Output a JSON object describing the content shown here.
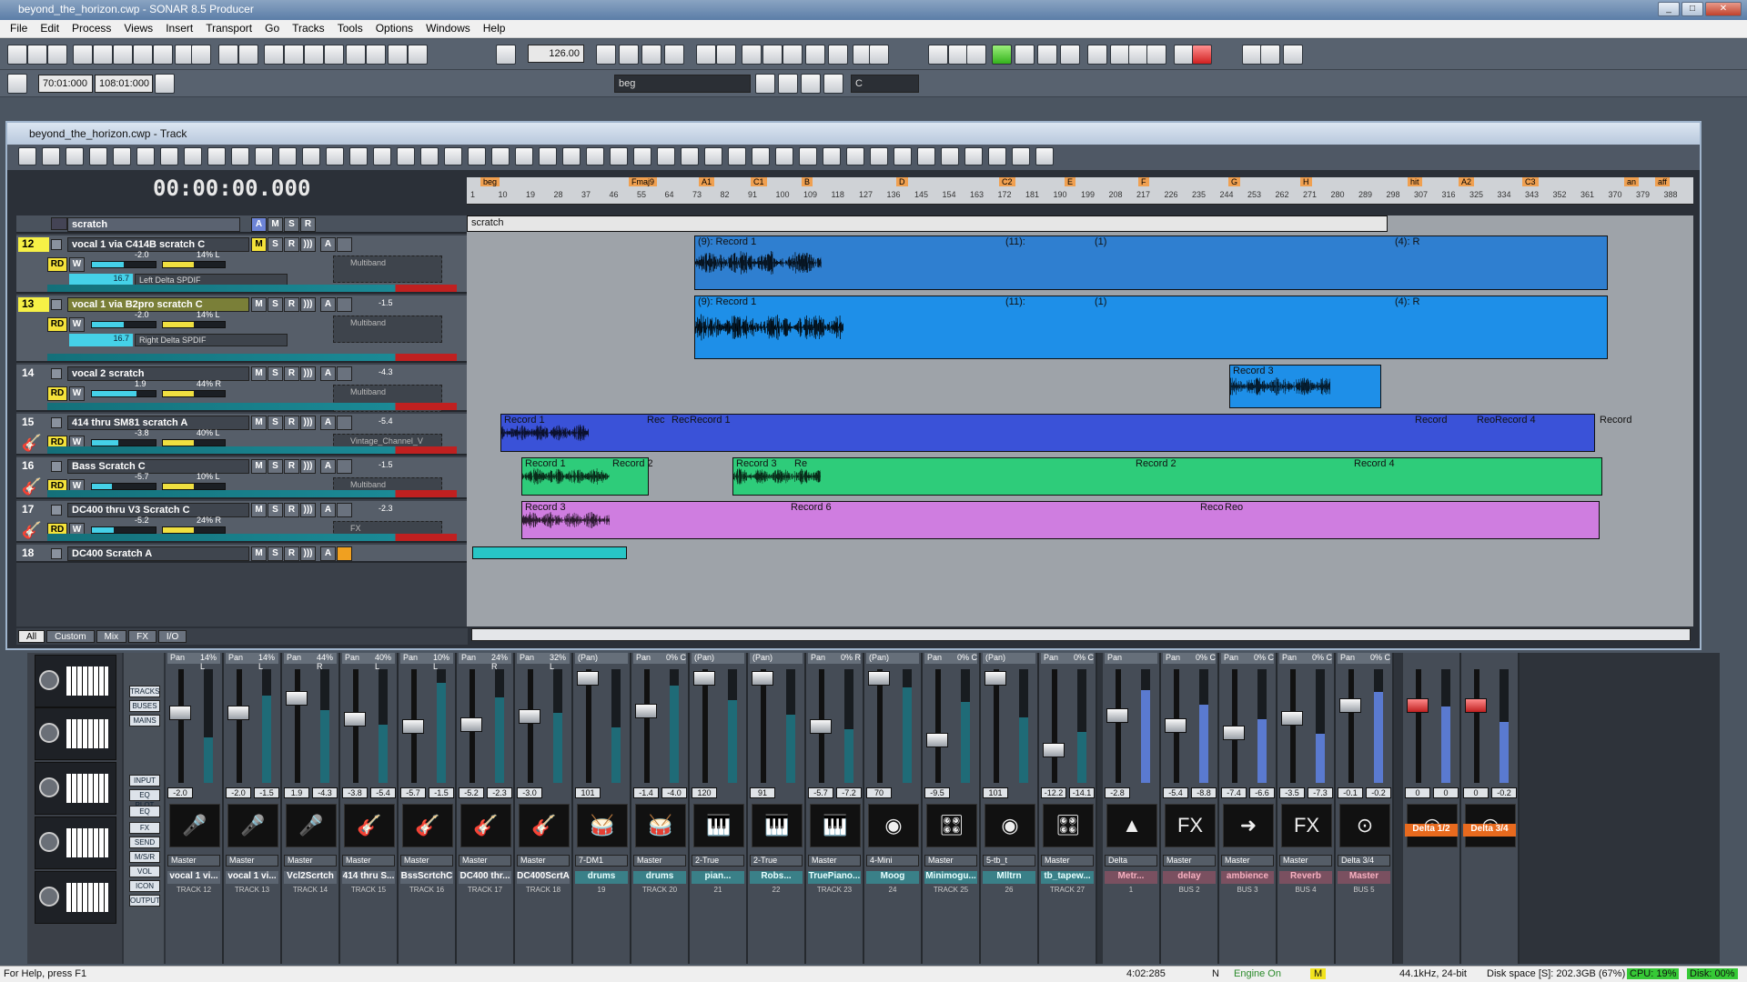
{
  "app_title": "beyond_the_horizon.cwp - SONAR 8.5 Producer",
  "menu": [
    "File",
    "Edit",
    "Process",
    "Views",
    "Insert",
    "Transport",
    "Go",
    "Tracks",
    "Tools",
    "Options",
    "Windows",
    "Help"
  ],
  "transport": {
    "tempo": "126.00",
    "loop_start": "70:01:000",
    "loop_end": "108:01:000",
    "marker": "beg",
    "key": "C"
  },
  "track_window": {
    "title": "beyond_the_horizon.cwp - Track",
    "time": "00:00:00.000",
    "ruler_numbers": [
      "1",
      "10",
      "19",
      "28",
      "37",
      "46",
      "55",
      "64",
      "73",
      "82",
      "91",
      "100",
      "109",
      "118",
      "127",
      "136",
      "145",
      "154",
      "163",
      "172",
      "181",
      "190",
      "199",
      "208",
      "217",
      "226",
      "235",
      "244",
      "253",
      "262",
      "271",
      "280",
      "289",
      "298",
      "307",
      "316",
      "325",
      "334",
      "343",
      "352",
      "361",
      "370",
      "379",
      "388"
    ],
    "ruler_markers": [
      "beg",
      "Fmaj9",
      "A1",
      "C1",
      "B",
      "D",
      "C2",
      "E",
      "F",
      "G",
      "H",
      "hit",
      "A2",
      "C3",
      "an",
      "aff"
    ],
    "folder": {
      "name": "scratch",
      "clip": "scratch"
    },
    "tracks": [
      {
        "num": "12",
        "name": "vocal 1 via C414B scratch C",
        "vol": "-2.0",
        "pan": "14% L",
        "trim": "16.7",
        "input": "Left Delta SPDIF",
        "fx": "Multiband",
        "db": "",
        "sel": true
      },
      {
        "num": "13",
        "name": "vocal 1 via B2pro scratch C",
        "vol": "-2.0",
        "pan": "14% L",
        "trim": "16.7",
        "input": "Right Delta SPDIF",
        "fx": "Multiband",
        "db": "-1.5",
        "sel": true
      },
      {
        "num": "14",
        "name": "vocal 2 scratch",
        "vol": "1.9",
        "pan": "44% R",
        "trim": "",
        "input": "",
        "fx": "Multiband",
        "db": "-4.3",
        "sel": false
      },
      {
        "num": "15",
        "name": "414 thru SM81 scratch A",
        "vol": "-3.8",
        "pan": "40% L",
        "trim": "",
        "input": "",
        "fx": "Vintage_Channel_V",
        "db": "-5.4",
        "sel": false
      },
      {
        "num": "16",
        "name": "Bass Scratch C",
        "vol": "-5.7",
        "pan": "10% L",
        "trim": "",
        "input": "",
        "fx": "Multiband",
        "db": "-1.5",
        "sel": false
      },
      {
        "num": "17",
        "name": "DC400 thru V3 Scratch C",
        "vol": "-5.2",
        "pan": "24% R",
        "trim": "",
        "input": "",
        "fx": "FX",
        "db": "-2.3",
        "sel": false
      },
      {
        "num": "18",
        "name": "DC400 Scratch A",
        "vol": "",
        "pan": "",
        "trim": "",
        "input": "",
        "fx": "",
        "db": "",
        "sel": false
      }
    ],
    "clip_labels": {
      "t12": [
        "(9): Record 1",
        "(11):",
        "(1)",
        "(4): R"
      ],
      "t13": [
        "(9): Record 1",
        "(11):",
        "(1)",
        "(4): R"
      ],
      "t14": [
        "Record 3"
      ],
      "t15": [
        "Record 1",
        "Rec",
        "Rec",
        "Record 1",
        "Record",
        "Reo",
        "Record 4",
        "Record"
      ],
      "t16": [
        "Record 1",
        "Record 2",
        "Record 3",
        "Re",
        "Record 2",
        "Record 4"
      ],
      "t17": [
        "Record 3",
        "Record 6",
        "Reco",
        "Reo"
      ]
    },
    "tabs": [
      "All",
      "Custom",
      "Mix",
      "FX",
      "I/O"
    ],
    "buttons": {
      "a": "A",
      "m": "M",
      "s": "S",
      "r": "R",
      "rd": "RD",
      "w": "W"
    }
  },
  "console": {
    "nav": [
      "TRACKS",
      "BUSES",
      "MAINS",
      "INPUT",
      "EQ PLOT",
      "EQ",
      "FX",
      "SEND",
      "M/S/R",
      "VOL",
      "ICON",
      "OUTPUT"
    ],
    "strips": [
      {
        "pan": "Pan",
        "pv": "14% L",
        "dv": [
          "-2.0",
          ""
        ],
        "icon": "🎤",
        "out": "Master",
        "name": "vocal 1 vi...",
        "tk": "TRACK 12",
        "style": ""
      },
      {
        "pan": "Pan",
        "pv": "14% L",
        "dv": [
          "-2.0",
          "-1.5"
        ],
        "icon": "🎤",
        "out": "Master",
        "name": "vocal 1 vi...",
        "tk": "TRACK 13",
        "style": ""
      },
      {
        "pan": "Pan",
        "pv": "44% R",
        "dv": [
          "1.9",
          "-4.3"
        ],
        "icon": "🎤",
        "out": "Master",
        "name": "Vcl2Scrtch",
        "tk": "TRACK 14",
        "style": ""
      },
      {
        "pan": "Pan",
        "pv": "40% L",
        "dv": [
          "-3.8",
          "-5.4"
        ],
        "icon": "🎸",
        "out": "Master",
        "name": "414 thru S...",
        "tk": "TRACK 15",
        "style": ""
      },
      {
        "pan": "Pan",
        "pv": "10% L",
        "dv": [
          "-5.7",
          "-1.5"
        ],
        "icon": "🎸",
        "out": "Master",
        "name": "BssScrtchC",
        "tk": "TRACK 16",
        "style": ""
      },
      {
        "pan": "Pan",
        "pv": "24% R",
        "dv": [
          "-5.2",
          "-2.3"
        ],
        "icon": "🎸",
        "out": "Master",
        "name": "DC400 thr...",
        "tk": "TRACK 17",
        "style": ""
      },
      {
        "pan": "Pan",
        "pv": "32% L",
        "dv": [
          "-3.0",
          ""
        ],
        "icon": "🎸",
        "out": "Master",
        "name": "DC400ScrtA",
        "tk": "TRACK 18",
        "style": ""
      },
      {
        "pan": "(Pan)",
        "pv": "",
        "dv": [
          "101",
          ""
        ],
        "icon": "🥁",
        "out": "7-DM1",
        "name": "drums",
        "tk": "19",
        "style": "teal"
      },
      {
        "pan": "Pan",
        "pv": "0% C",
        "dv": [
          "-1.4",
          "-4.0"
        ],
        "icon": "🥁",
        "out": "Master",
        "name": "drums",
        "tk": "TRACK 20",
        "style": "teal"
      },
      {
        "pan": "(Pan)",
        "pv": "",
        "dv": [
          "120",
          ""
        ],
        "icon": "🎹",
        "out": "2-True",
        "name": "pian...",
        "tk": "21",
        "style": "teal"
      },
      {
        "pan": "(Pan)",
        "pv": "",
        "dv": [
          "91",
          ""
        ],
        "icon": "🎹",
        "out": "2-True",
        "name": "Robs...",
        "tk": "22",
        "style": "teal"
      },
      {
        "pan": "Pan",
        "pv": "0% R",
        "dv": [
          "-5.7",
          "-7.2"
        ],
        "icon": "🎹",
        "out": "Master",
        "name": "TruePiano...",
        "tk": "TRACK 23",
        "style": "teal"
      },
      {
        "pan": "(Pan)",
        "pv": "",
        "dv": [
          "70",
          ""
        ],
        "icon": "◉",
        "out": "4-Mini",
        "name": "Moog",
        "tk": "24",
        "style": "teal"
      },
      {
        "pan": "Pan",
        "pv": "0% C",
        "dv": [
          "-9.5",
          ""
        ],
        "icon": "🎛",
        "out": "Master",
        "name": "Minimogu...",
        "tk": "TRACK 25",
        "style": "teal"
      },
      {
        "pan": "(Pan)",
        "pv": "",
        "dv": [
          "101",
          ""
        ],
        "icon": "◉",
        "out": "5-tb_t",
        "name": "Mlltrn",
        "tk": "26",
        "style": "teal"
      },
      {
        "pan": "Pan",
        "pv": "0% C",
        "dv": [
          "-12.2",
          "-14.1"
        ],
        "icon": "🎛",
        "out": "Master",
        "name": "tb_tapew...",
        "tk": "TRACK 27",
        "style": "teal"
      },
      {
        "pan": "Pan",
        "pv": "",
        "dv": [
          "-2.8",
          ""
        ],
        "icon": "▲",
        "out": "Delta",
        "name": "Metr...",
        "tk": "1",
        "style": "red"
      },
      {
        "pan": "Pan",
        "pv": "0% C",
        "dv": [
          "-5.4",
          "-8.8"
        ],
        "icon": "FX",
        "out": "Master",
        "name": "delay",
        "tk": "BUS 2",
        "style": "red"
      },
      {
        "pan": "Pan",
        "pv": "0% C",
        "dv": [
          "-7.4",
          "-6.6"
        ],
        "icon": "➜",
        "out": "Master",
        "name": "ambience",
        "tk": "BUS 3",
        "style": "red"
      },
      {
        "pan": "Pan",
        "pv": "0% C",
        "dv": [
          "-3.5",
          "-7.3"
        ],
        "icon": "FX",
        "out": "Master",
        "name": "Reverb",
        "tk": "BUS 4",
        "style": "red"
      },
      {
        "pan": "Pan",
        "pv": "0% C",
        "dv": [
          "-0.1",
          "-0.2"
        ],
        "icon": "⊙",
        "out": "Delta 3/4",
        "name": "Master",
        "tk": "BUS 5",
        "style": "red"
      },
      {
        "pan": "",
        "pv": "",
        "dv": [
          "0",
          "0"
        ],
        "icon": "◎",
        "out": "",
        "name": "Delta 1/2",
        "tk": "",
        "style": "org"
      },
      {
        "pan": "",
        "pv": "",
        "dv": [
          "0",
          "-0.2"
        ],
        "icon": "◎",
        "out": "",
        "name": "Delta 3/4",
        "tk": "",
        "style": "org"
      }
    ]
  },
  "status": {
    "help": "For Help, press F1",
    "time": "4:02:285",
    "n": "N",
    "engine": "Engine On",
    "m": "M",
    "rate": "44.1kHz, 24-bit",
    "disk": "Disk space [S]: 202.3GB (67%)",
    "cpu": "CPU: 19%",
    "diskp": "Disk: 00%"
  }
}
